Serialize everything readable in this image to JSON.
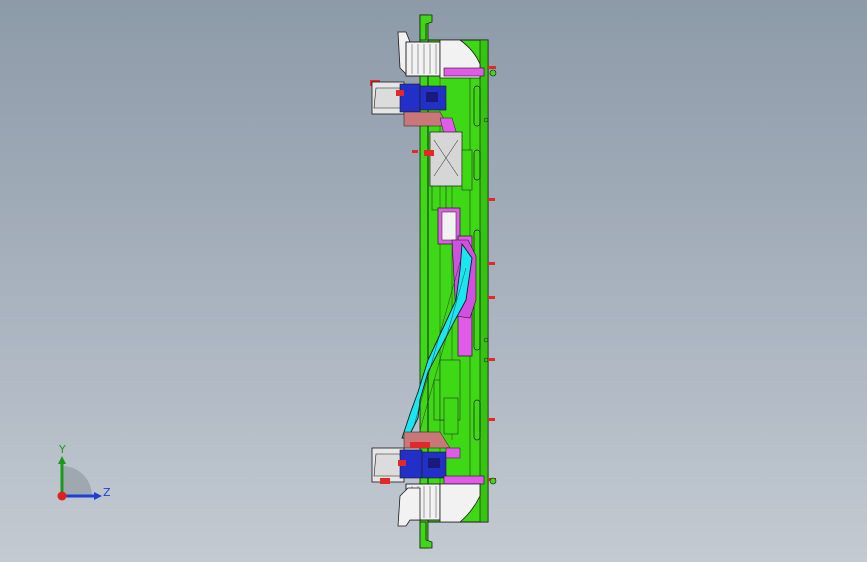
{
  "viewport": {
    "background_top": "#8d9aa8",
    "background_bottom": "#c3cad2"
  },
  "model": {
    "colors": {
      "fixture_plate": "#3fd816",
      "plate_edge": "#1f8a00",
      "part": "#19e6f0",
      "clamp": "#e05ce8",
      "locator": "#2230c8",
      "pin": "#e22828",
      "housing": "#f2f2f2",
      "outline": "#1a1a1a"
    }
  },
  "triad": {
    "y_label": "Y",
    "z_label": "Z",
    "y_color": "#1a9a1a",
    "z_color": "#1f3fd4",
    "x_color": "#e02020"
  }
}
